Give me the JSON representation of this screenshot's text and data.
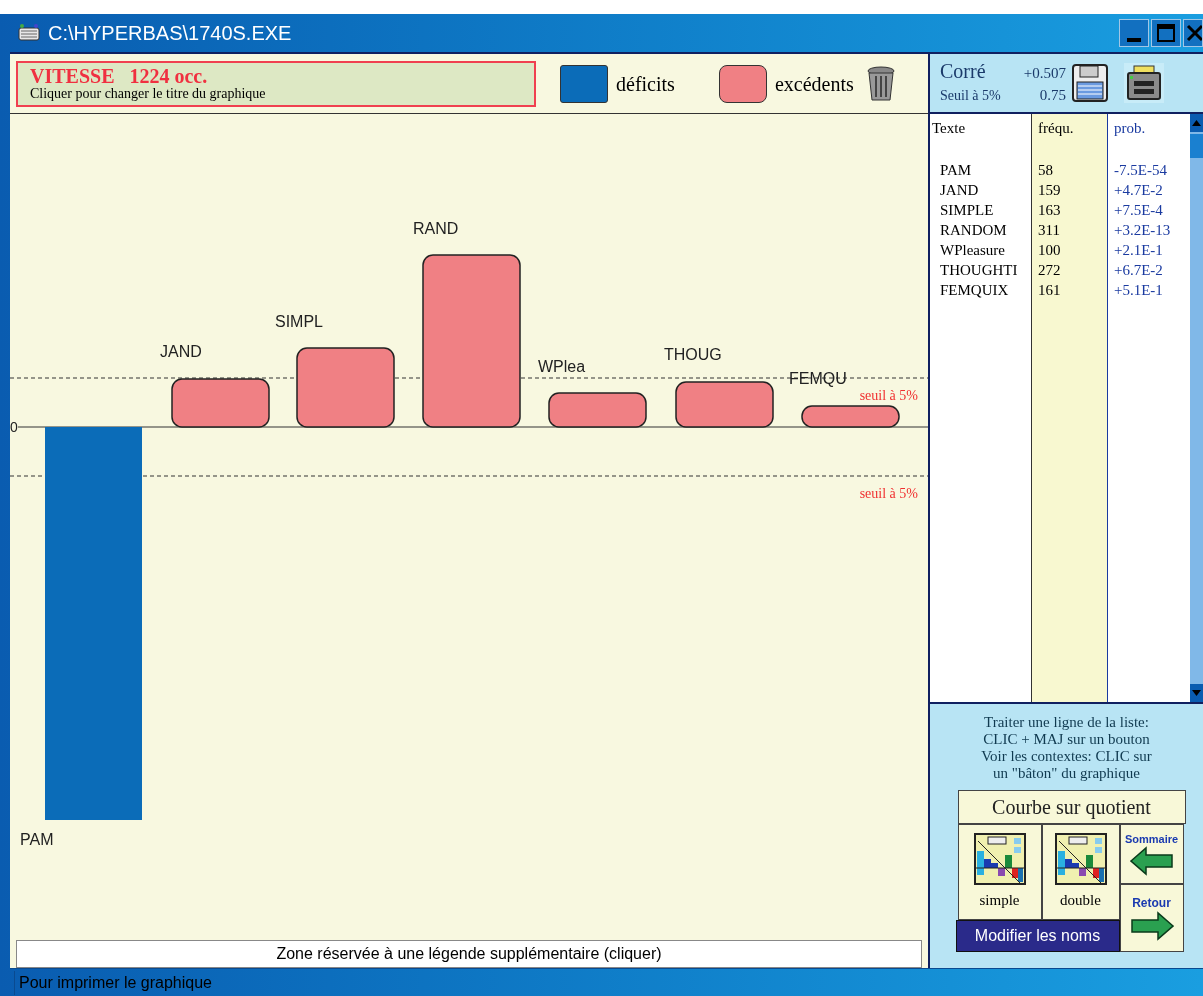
{
  "window": {
    "title": "C:\\HYPERBAS\\1740S.EXE"
  },
  "graph_title": {
    "word": "VITESSE",
    "count": "1224 occ.",
    "hint": "Cliquer pour changer le titre du graphique"
  },
  "legend": [
    {
      "label": "déficits",
      "color": "#0b6cb8"
    },
    {
      "label": "excédents",
      "color": "#f08084"
    }
  ],
  "stats": {
    "corr_label": "Corré",
    "corr_value": "+0.507",
    "threshold_label": "Seuil à 5%",
    "threshold_value": "0.75"
  },
  "chart": {
    "zero_label": "0",
    "threshold_labels": [
      "seuil à 5%",
      "seuil à 5%"
    ],
    "bars": [
      {
        "label": "PAM",
        "kind": "deficit"
      },
      {
        "label": "JAND",
        "kind": "excess"
      },
      {
        "label": "SIMPL",
        "kind": "excess"
      },
      {
        "label": "RAND",
        "kind": "excess"
      },
      {
        "label": "WPlea",
        "kind": "excess"
      },
      {
        "label": "THOUG",
        "kind": "excess"
      },
      {
        "label": "FEMQU",
        "kind": "excess"
      }
    ]
  },
  "table": {
    "columns": [
      "Texte",
      "fréqu.",
      "prob."
    ],
    "rows": [
      [
        "PAM",
        "58",
        "-7.5E-54"
      ],
      [
        "JAND",
        "159",
        "+4.7E-2"
      ],
      [
        "SIMPLE",
        "163",
        "+7.5E-4"
      ],
      [
        "RANDOM",
        "311",
        "+3.2E-13"
      ],
      [
        "WPleasure",
        "100",
        "+2.1E-1"
      ],
      [
        "THOUGHTI",
        "272",
        "+6.7E-2"
      ],
      [
        "FEMQUIX",
        "161",
        "+5.1E-1"
      ]
    ]
  },
  "help_text": [
    "Traiter une ligne de la liste:",
    "CLIC + MAJ sur un bouton",
    "Voir les contextes: CLIC sur",
    "un \"bâton\" du graphique"
  ],
  "buttons": {
    "curve": "Courbe sur quotient",
    "simple": "simple",
    "double": "double",
    "summary": "Sommaire",
    "back": "Retour",
    "rename": "Modifier les noms"
  },
  "legend_zone": "Zone réservée à une légende supplémentaire (cliquer)",
  "status_bar": "Pour imprimer le graphique"
}
